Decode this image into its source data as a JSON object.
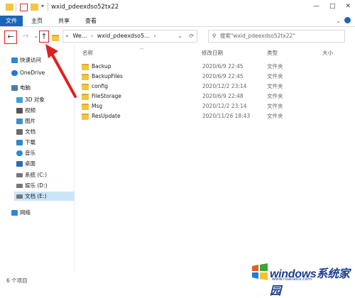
{
  "window": {
    "title": "wxid_pdeexdso52tx22",
    "controls": [
      "—",
      "□",
      "✕"
    ]
  },
  "ribbon": {
    "tabs": [
      "文件",
      "主页",
      "共享",
      "查看"
    ]
  },
  "nav": {
    "back_icon": "←",
    "forward_icon": "→",
    "recent_icon": "⌄",
    "up_icon": "↑",
    "address_prefix": "«",
    "address_parts": [
      "We...",
      "wxid_pdeexdso5..."
    ],
    "refresh_icon": "⟳",
    "search_placeholder": "搜索\"wxid_pdeexdso52tx22\""
  },
  "sidebar": {
    "items": [
      {
        "label": "快速访问",
        "icon": "star-icon",
        "color": "#2b88d8"
      },
      {
        "label": "OneDrive",
        "icon": "cloud-icon",
        "color": "#1e78d6"
      },
      {
        "label": "电脑",
        "icon": "computer-icon",
        "color": "#4a7ab0"
      },
      {
        "label": "3D 对象",
        "icon": "cube-icon",
        "color": "#3aa0d8"
      },
      {
        "label": "视频",
        "icon": "video-icon",
        "color": "#555555"
      },
      {
        "label": "图片",
        "icon": "picture-icon",
        "color": "#3a8fc7"
      },
      {
        "label": "文档",
        "icon": "document-icon",
        "color": "#6a6a6a"
      },
      {
        "label": "下载",
        "icon": "download-icon",
        "color": "#2b88d8"
      },
      {
        "label": "音乐",
        "icon": "music-icon",
        "color": "#2b88d8"
      },
      {
        "label": "桌面",
        "icon": "desktop-icon",
        "color": "#2b6cb0"
      },
      {
        "label": "系统 (C:)",
        "icon": "drive-icon",
        "color": "#777777"
      },
      {
        "label": "娱乐 (D:)",
        "icon": "drive-icon",
        "color": "#777777"
      },
      {
        "label": "文档 (E:)",
        "icon": "drive-icon",
        "color": "#777777"
      },
      {
        "label": "网络",
        "icon": "network-icon",
        "color": "#2b88d8"
      }
    ]
  },
  "columns": [
    "名称",
    "修改日期",
    "类型",
    "大小"
  ],
  "files": [
    {
      "name": "Backup",
      "date": "2020/6/9 22:45",
      "type": "文件夹"
    },
    {
      "name": "BackupFiles",
      "date": "2020/6/9 22:45",
      "type": "文件夹"
    },
    {
      "name": "config",
      "date": "2020/12/2 23:14",
      "type": "文件夹"
    },
    {
      "name": "FileStorage",
      "date": "2020/6/9 22:48",
      "type": "文件夹"
    },
    {
      "name": "Msg",
      "date": "2020/12/2 23:14",
      "type": "文件夹"
    },
    {
      "name": "ResUpdate",
      "date": "2020/11/26 18:43",
      "type": "文件夹"
    }
  ],
  "status": {
    "count": "6 个项目"
  },
  "watermark": {
    "brand": "windows系统家园",
    "url": "www.ruanaitu.com"
  },
  "colors": {
    "accent": "#1c66b8",
    "annotation": "#e02020",
    "folder": "#f4c542",
    "selected": "#cce4f7"
  }
}
